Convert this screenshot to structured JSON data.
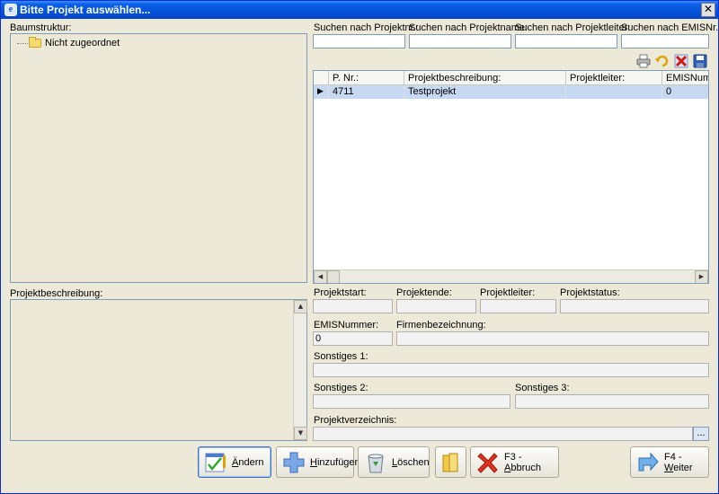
{
  "window": {
    "title": "Bitte Projekt auswählen...",
    "app_icon_glyph": "e",
    "close_glyph": "✕"
  },
  "tree": {
    "label": "Baumstruktur:",
    "root": "Nicht zugeordnet"
  },
  "search": {
    "nr_label": "Suchen nach Projektnr.:",
    "name_label": "Suchen nach Projektname:",
    "leiter_label": "Suchen nach Projektleiter:",
    "emis_label": "Suchen nach EMISNr.:",
    "nr_value": "",
    "name_value": "",
    "leiter_value": "",
    "emis_value": ""
  },
  "toolbar": {
    "icons": [
      "printer-icon",
      "undo-icon",
      "delete-icon",
      "save-icon"
    ]
  },
  "grid": {
    "columns": [
      "",
      "P. Nr.:",
      "Projektbeschreibung:",
      "Projektleiter:",
      "EMISNumm"
    ],
    "rows": [
      {
        "indicator": "▶",
        "nr": "4711",
        "beschreibung": "Testprojekt",
        "leiter": "",
        "emis": "0"
      }
    ]
  },
  "description": {
    "label": "Projektbeschreibung:",
    "value": ""
  },
  "details": {
    "start_label": "Projektstart:",
    "start_value": "",
    "ende_label": "Projektende:",
    "ende_value": "",
    "leiter_label": "Projektleiter:",
    "leiter_value": "",
    "status_label": "Projektstatus:",
    "status_value": "",
    "emis_label": "EMISNummer:",
    "emis_value": "0",
    "firma_label": "Firmenbezeichnung:",
    "firma_value": "",
    "sonst1_label": "Sonstiges 1:",
    "sonst1_value": "",
    "sonst2_label": "Sonstiges 2:",
    "sonst2_value": "",
    "sonst3_label": "Sonstiges 3:",
    "sonst3_value": "",
    "verz_label": "Projektverzeichnis:",
    "verz_value": "",
    "browse_label": "..."
  },
  "buttons": {
    "aendern_first": "Ä",
    "aendern_rest": "ndern",
    "hinzu_first": "H",
    "hinzu_rest": "inzufügen",
    "loeschen_first": "L",
    "loeschen_rest": "öschen",
    "abbruch_prefix": "F3 - ",
    "abbruch_first": "A",
    "abbruch_rest": "bbruch",
    "weiter_prefix": "F4 - ",
    "weiter_first": "W",
    "weiter_rest": "eiter"
  }
}
